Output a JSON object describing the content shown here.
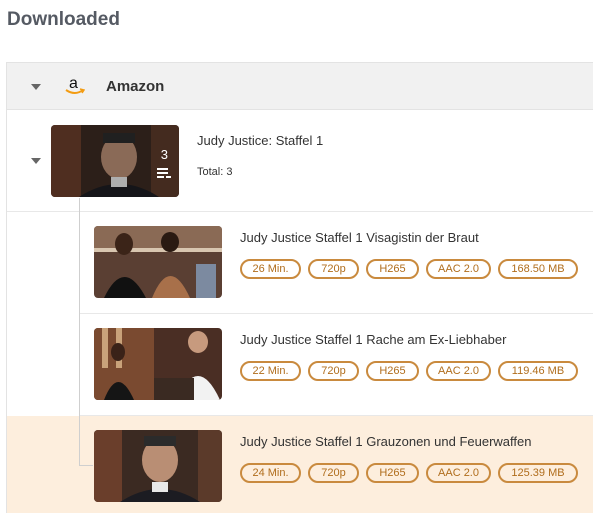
{
  "page": {
    "title": "Downloaded"
  },
  "group": {
    "name": "Amazon",
    "icon": "amazon-logo-icon"
  },
  "season": {
    "title": "Judy Justice: Staffel 1",
    "count": "3",
    "total": "Total: 3"
  },
  "episodes": [
    {
      "title": "Judy Justice Staffel 1 Visagistin der Braut",
      "tags": [
        "26 Min.",
        "720p",
        "H265",
        "AAC 2.0",
        "168.50 MB"
      ],
      "selected": false
    },
    {
      "title": "Judy Justice Staffel 1 Rache am Ex-Liebhaber",
      "tags": [
        "22 Min.",
        "720p",
        "H265",
        "AAC 2.0",
        "119.46 MB"
      ],
      "selected": false
    },
    {
      "title": "Judy Justice Staffel 1 Grauzonen und Feuerwaffen",
      "tags": [
        "24 Min.",
        "720p",
        "H265",
        "AAC 2.0",
        "125.39 MB"
      ],
      "selected": true
    }
  ],
  "colors": {
    "accent": "#c98a3e",
    "selected_row": "#fdeedd",
    "header_bg": "#f1f1f1"
  }
}
